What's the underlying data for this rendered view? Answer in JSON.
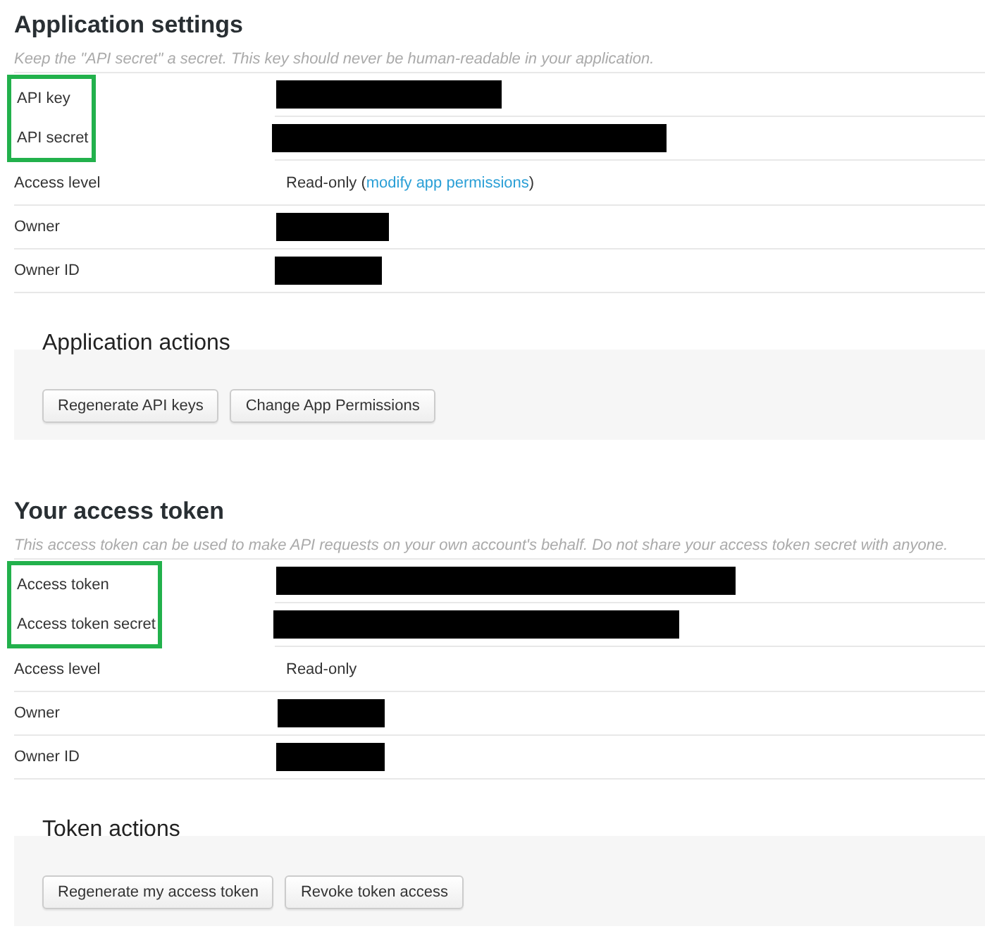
{
  "sections": [
    {
      "title": "Application settings",
      "subtitle": "Keep the \"API secret\" a secret. This key should never be human-readable in your application.",
      "rows": [
        {
          "label": "API key",
          "kind": "redacted",
          "highlighted": true
        },
        {
          "label": "API secret",
          "kind": "redacted",
          "highlighted": true
        },
        {
          "label": "Access level",
          "kind": "text",
          "highlighted": false,
          "value": "Read-only (",
          "link": "modify app permissions",
          "after": ")"
        },
        {
          "label": "Owner",
          "kind": "redacted",
          "highlighted": false
        },
        {
          "label": "Owner ID",
          "kind": "redacted",
          "highlighted": false
        }
      ],
      "actions": {
        "title": "Application actions",
        "buttons": [
          "Regenerate API keys",
          "Change App Permissions"
        ]
      }
    },
    {
      "title": "Your access token",
      "subtitle": "This access token can be used to make API requests on your own account's behalf. Do not share your access token secret with anyone.",
      "rows": [
        {
          "label": "Access token",
          "kind": "redacted",
          "highlighted": true
        },
        {
          "label": "Access token secret",
          "kind": "redacted",
          "highlighted": true
        },
        {
          "label": "Access level",
          "kind": "text",
          "highlighted": false,
          "value": "Read-only"
        },
        {
          "label": "Owner",
          "kind": "redacted",
          "highlighted": false
        },
        {
          "label": "Owner ID",
          "kind": "redacted",
          "highlighted": false
        }
      ],
      "actions": {
        "title": "Token actions",
        "buttons": [
          "Regenerate my access token",
          "Revoke token access"
        ]
      }
    }
  ]
}
